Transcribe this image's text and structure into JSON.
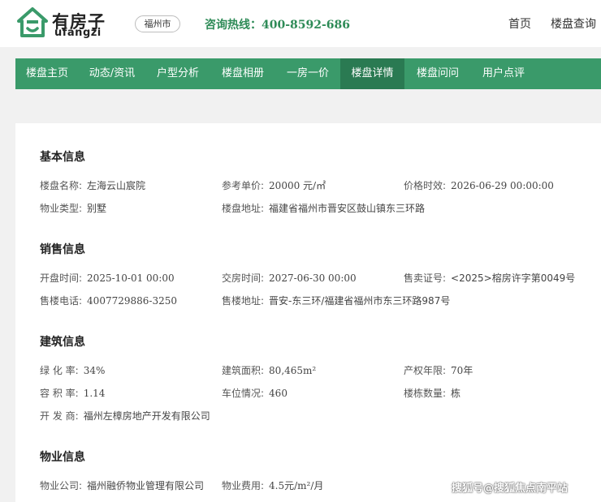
{
  "header": {
    "logo_cn": "有房子",
    "logo_en": "ufangzi",
    "city": "福州市",
    "hotline_label": "咨询热线：",
    "hotline_number": "400-8592-686",
    "links": [
      "首页",
      "楼盘查询"
    ]
  },
  "nav": {
    "items": [
      "楼盘主页",
      "动态/资讯",
      "户型分析",
      "楼盘相册",
      "一房一价",
      "楼盘详情",
      "楼盘问问",
      "用户点评"
    ],
    "active_index": 5
  },
  "sections": {
    "basic": {
      "title": "基本信息",
      "name_label": "楼盘名称:",
      "name_value": "左海云山宸院",
      "price_label": "参考单价:",
      "price_value": "20000 元/㎡",
      "price_time_label": "价格时效:",
      "price_time_value": "2026-06-29 00:00:00",
      "type_label": "物业类型:",
      "type_value": "别墅",
      "address_label": "楼盘地址:",
      "address_value": "福建省福州市晋安区鼓山镇东三环路"
    },
    "sales": {
      "title": "销售信息",
      "open_label": "开盘时间:",
      "open_value": "2025-10-01 00:00",
      "delivery_label": "交房时间:",
      "delivery_value": "2027-06-30 00:00",
      "permit_label": "售卖证号:",
      "permit_value": "<2025>榕房许字第0049号",
      "phone_label": "售楼电话:",
      "phone_value": "4007729886-3250",
      "sales_addr_label": "售楼地址:",
      "sales_addr_value": "晋安-东三环/福建省福州市东三环路987号"
    },
    "building": {
      "title": "建筑信息",
      "green_label": "绿 化 率:",
      "green_value": "34%",
      "area_label": "建筑面积:",
      "area_value": "80,465m²",
      "years_label": "产权年限:",
      "years_value": "70年",
      "far_label": "容 积 率:",
      "far_value": "1.14",
      "parking_label": "车位情况:",
      "parking_value": "460",
      "count_label": "楼栋数量:",
      "count_value": "栋",
      "dev_label": "开 发 商:",
      "dev_value": "福州左樟房地产开发有限公司"
    },
    "property": {
      "title": "物业信息",
      "company_label": "物业公司:",
      "company_value": "福州融侨物业管理有限公司",
      "fee_label": "物业费用:",
      "fee_value": "4.5元/m²/月"
    }
  },
  "watermark": "搜狐号@搜狐焦点南平站",
  "colors": {
    "brand_green": "#3a9a6a",
    "active_green": "#2a7a52",
    "hotline_green": "#2e8b57"
  }
}
